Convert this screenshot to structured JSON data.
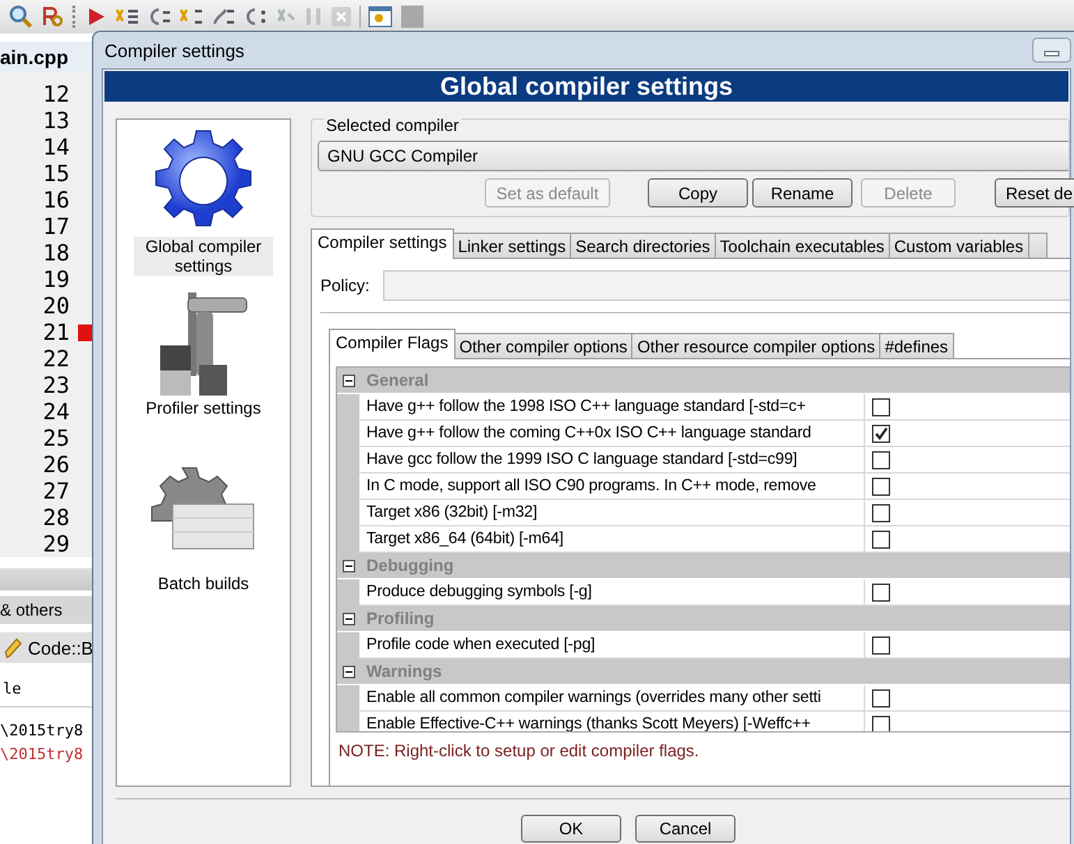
{
  "editor": {
    "tab": "ain.cpp",
    "lines": [
      {
        "number": "12",
        "breakpoint": false
      },
      {
        "number": "13",
        "breakpoint": false
      },
      {
        "number": "14",
        "breakpoint": false
      },
      {
        "number": "15",
        "breakpoint": false
      },
      {
        "number": "16",
        "breakpoint": false
      },
      {
        "number": "17",
        "breakpoint": false
      },
      {
        "number": "18",
        "breakpoint": false
      },
      {
        "number": "19",
        "breakpoint": false
      },
      {
        "number": "20",
        "breakpoint": false
      },
      {
        "number": "21",
        "breakpoint": true
      },
      {
        "number": "22",
        "breakpoint": false
      },
      {
        "number": "23",
        "breakpoint": false
      },
      {
        "number": "24",
        "breakpoint": false
      },
      {
        "number": "25",
        "breakpoint": false
      },
      {
        "number": "26",
        "breakpoint": false
      },
      {
        "number": "27",
        "breakpoint": false
      },
      {
        "number": "28",
        "breakpoint": false
      },
      {
        "number": "29",
        "breakpoint": false
      }
    ]
  },
  "bottom_panel": {
    "tab": "& others",
    "log_tab": "Code::B",
    "column_header": "le",
    "log_lines": [
      {
        "text": "\\2015try8",
        "kind": "normal"
      },
      {
        "text": "\\2015try8",
        "kind": "error"
      }
    ]
  },
  "dialog": {
    "title": "Compiler settings",
    "header": "Global compiler settings",
    "categories": [
      {
        "label": "Global compiler settings",
        "selected": true
      },
      {
        "label": "Profiler settings",
        "selected": false
      },
      {
        "label": "Batch builds",
        "selected": false
      }
    ],
    "selected_compiler_label": "Selected compiler",
    "compiler": "GNU GCC Compiler",
    "buttons": [
      {
        "label": "Set as default",
        "disabled": true
      },
      {
        "label": "Copy",
        "disabled": false
      },
      {
        "label": "Rename",
        "disabled": false
      },
      {
        "label": "Delete",
        "disabled": true
      },
      {
        "label": "Reset de",
        "disabled": false
      }
    ],
    "tabs": [
      {
        "label": "Compiler settings",
        "selected": true
      },
      {
        "label": "Linker settings",
        "selected": false
      },
      {
        "label": "Search directories",
        "selected": false
      },
      {
        "label": "Toolchain executables",
        "selected": false
      },
      {
        "label": "Custom variables",
        "selected": false
      }
    ],
    "policy_label": "Policy:",
    "subtabs": [
      {
        "label": "Compiler Flags",
        "selected": true
      },
      {
        "label": "Other compiler options",
        "selected": false
      },
      {
        "label": "Other resource compiler options",
        "selected": false
      },
      {
        "label": "#defines",
        "selected": false
      }
    ],
    "flag_groups": [
      {
        "name": "General",
        "expanded": true,
        "flags": [
          {
            "label": "Have g++ follow the 1998 ISO C++ language standard  [-std=c+",
            "checked": false
          },
          {
            "label": "Have g++ follow the coming C++0x ISO C++ language standard",
            "checked": true
          },
          {
            "label": "Have gcc follow the 1999 ISO C language standard  [-std=c99]",
            "checked": false
          },
          {
            "label": "In C mode, support all ISO C90 programs. In C++ mode, remove",
            "checked": false
          },
          {
            "label": "Target x86 (32bit)  [-m32]",
            "checked": false
          },
          {
            "label": "Target x86_64 (64bit)  [-m64]",
            "checked": false
          }
        ]
      },
      {
        "name": "Debugging",
        "expanded": true,
        "flags": [
          {
            "label": "Produce debugging symbols  [-g]",
            "checked": false
          }
        ]
      },
      {
        "name": "Profiling",
        "expanded": true,
        "flags": [
          {
            "label": "Profile code when executed  [-pg]",
            "checked": false
          }
        ]
      },
      {
        "name": "Warnings",
        "expanded": true,
        "flags": [
          {
            "label": "Enable all common compiler warnings (overrides many other setti",
            "checked": false
          },
          {
            "label": "Enable Effective-C++ warnings (thanks Scott Meyers)  [-Weffc++",
            "checked": false
          }
        ]
      }
    ],
    "note": "NOTE: Right-click to setup or edit compiler flags.",
    "footer_buttons": [
      "OK",
      "Cancel"
    ]
  }
}
